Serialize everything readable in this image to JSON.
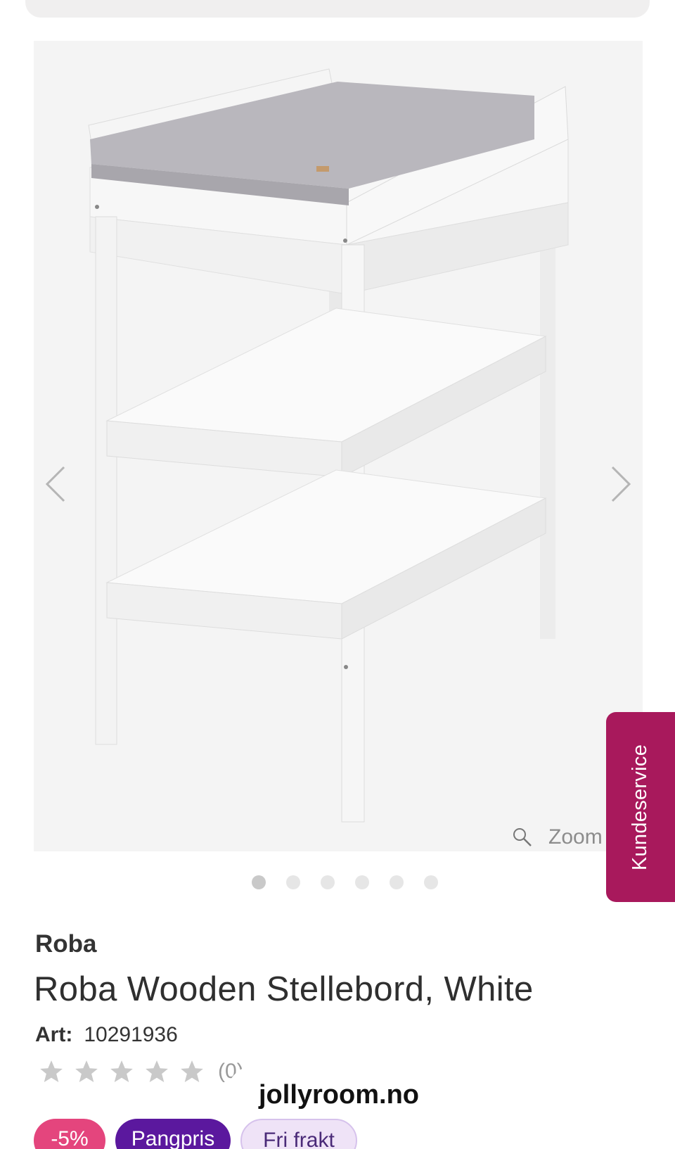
{
  "gallery": {
    "image_alt": "Roba Wooden Stellebord, White",
    "prev_icon": "chevron-left-icon",
    "next_icon": "chevron-right-icon",
    "zoom_label": "Zoom",
    "dots_count": 6,
    "active_dot": 0
  },
  "support_tab": {
    "label": "Kundeservice",
    "color": "#a8195c"
  },
  "product": {
    "brand": "Roba",
    "title": "Roba Wooden Stellebord, White",
    "art_label": "Art:",
    "art_number": "10291936",
    "rating": {
      "stars": 5,
      "filled": 0,
      "count_text": "(0)"
    }
  },
  "watermark": "jollyroom.no",
  "badges": [
    {
      "label": "-5%",
      "color": "#e4457d"
    },
    {
      "label": "Pangpris",
      "color": "#5b189e"
    },
    {
      "label": "Fri frakt",
      "color": "#efe3f7"
    }
  ]
}
